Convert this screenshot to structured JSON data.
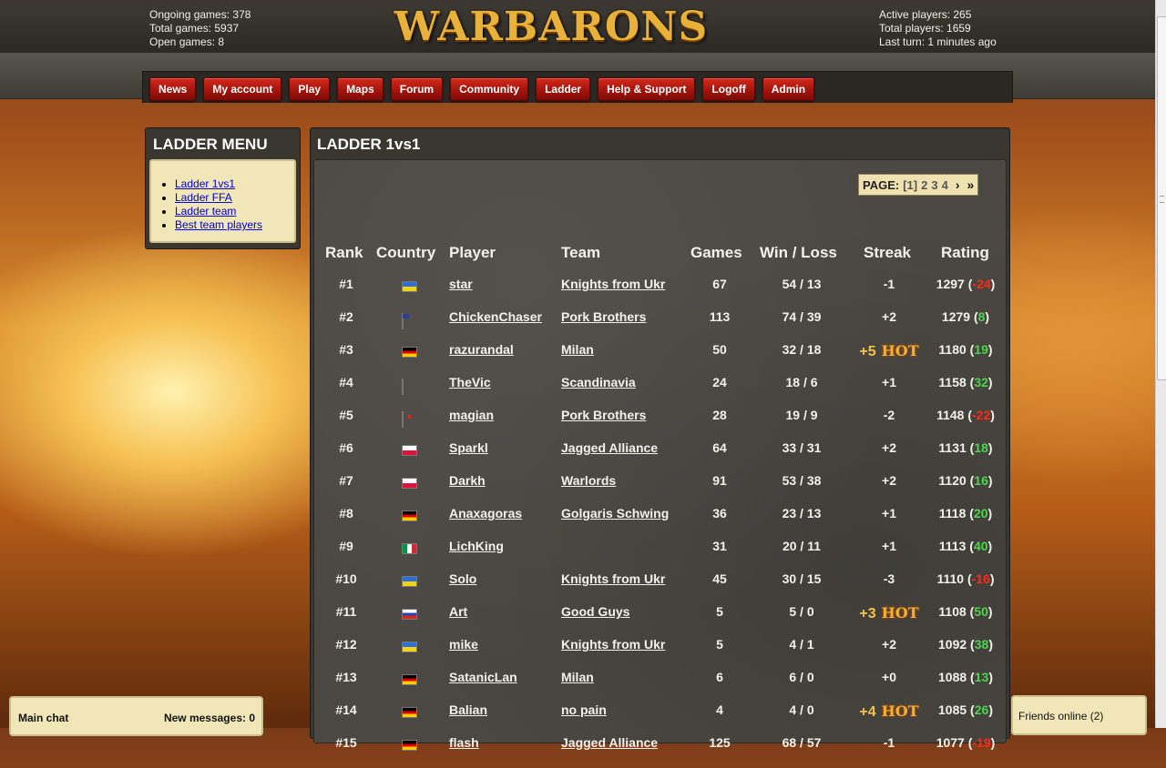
{
  "header": {
    "logo": "WARBARONS",
    "stats_left": [
      "Ongoing games: 378",
      "Total games: 5937",
      "Open games: 8"
    ],
    "stats_right": [
      "Active players: 265",
      "Total players: 1659",
      "Last turn: 1 minutes ago"
    ]
  },
  "nav": [
    "News",
    "My account",
    "Play",
    "Maps",
    "Forum",
    "Community",
    "Ladder",
    "Help & Support",
    "Logoff",
    "Admin"
  ],
  "ladder_menu": {
    "title": "LADDER MENU",
    "items": [
      "Ladder 1vs1",
      "Ladder FFA",
      "Ladder team",
      "Best team players"
    ]
  },
  "main": {
    "title": "LADDER 1vs1",
    "pager": {
      "label": "PAGE:",
      "current": "[1]",
      "pages": [
        "2",
        "3",
        "4"
      ],
      "next": "›",
      "last": "»"
    },
    "columns": [
      "Rank",
      "Country",
      "Player",
      "Team",
      "Games",
      "Win / Loss",
      "Streak",
      "Rating"
    ],
    "rows": [
      {
        "rank": "#1",
        "flag": "ua",
        "player": "star",
        "team": "Knights from Ukr",
        "games": "67",
        "wl": "54 / 13",
        "streak": "-1",
        "hot": false,
        "rating": "1297",
        "delta": "-24"
      },
      {
        "rank": "#2",
        "flag": "us",
        "player": "ChickenChaser",
        "team": "Pork Brothers",
        "games": "113",
        "wl": "74 / 39",
        "streak": "+2",
        "hot": false,
        "rating": "1279",
        "delta": "8"
      },
      {
        "rank": "#3",
        "flag": "de",
        "player": "razurandal",
        "team": "Milan",
        "games": "50",
        "wl": "32 / 18",
        "streak": "+5",
        "hot": true,
        "rating": "1180",
        "delta": "19"
      },
      {
        "rank": "#4",
        "flag": "se",
        "player": "TheVic",
        "team": "Scandinavia",
        "games": "24",
        "wl": "18 / 6",
        "streak": "+1",
        "hot": false,
        "rating": "1158",
        "delta": "32"
      },
      {
        "rank": "#5",
        "flag": "ca",
        "player": "magian",
        "team": "Pork Brothers",
        "games": "28",
        "wl": "19 / 9",
        "streak": "-2",
        "hot": false,
        "rating": "1148",
        "delta": "-22"
      },
      {
        "rank": "#6",
        "flag": "pl",
        "player": "Sparkl",
        "team": "Jagged Alliance",
        "games": "64",
        "wl": "33 / 31",
        "streak": "+2",
        "hot": false,
        "rating": "1131",
        "delta": "18"
      },
      {
        "rank": "#7",
        "flag": "pl",
        "player": "Darkh",
        "team": "Warlords",
        "games": "91",
        "wl": "53 / 38",
        "streak": "+2",
        "hot": false,
        "rating": "1120",
        "delta": "16"
      },
      {
        "rank": "#8",
        "flag": "de",
        "player": "Anaxagoras",
        "team": "Golgaris Schwing",
        "games": "36",
        "wl": "23 / 13",
        "streak": "+1",
        "hot": false,
        "rating": "1118",
        "delta": "20"
      },
      {
        "rank": "#9",
        "flag": "it",
        "player": "LichKing",
        "team": "",
        "games": "31",
        "wl": "20 / 11",
        "streak": "+1",
        "hot": false,
        "rating": "1113",
        "delta": "40"
      },
      {
        "rank": "#10",
        "flag": "ua",
        "player": "Solo",
        "team": "Knights from Ukr",
        "games": "45",
        "wl": "30 / 15",
        "streak": "-3",
        "hot": false,
        "rating": "1110",
        "delta": "-16"
      },
      {
        "rank": "#11",
        "flag": "ru",
        "player": "Art",
        "team": "Good Guys",
        "games": "5",
        "wl": "5 / 0",
        "streak": "+3",
        "hot": true,
        "rating": "1108",
        "delta": "50"
      },
      {
        "rank": "#12",
        "flag": "ua",
        "player": "mike",
        "team": "Knights from Ukr",
        "games": "5",
        "wl": "4 / 1",
        "streak": "+2",
        "hot": false,
        "rating": "1092",
        "delta": "38"
      },
      {
        "rank": "#13",
        "flag": "de",
        "player": "SatanicLan",
        "team": "Milan",
        "games": "6",
        "wl": "6 / 0",
        "streak": "+0",
        "hot": false,
        "rating": "1088",
        "delta": "13"
      },
      {
        "rank": "#14",
        "flag": "de",
        "player": "Balian",
        "team": "no pain",
        "games": "4",
        "wl": "4 / 0",
        "streak": "+4",
        "hot": true,
        "rating": "1085",
        "delta": "26"
      },
      {
        "rank": "#15",
        "flag": "de",
        "player": "flash",
        "team": "Jagged Alliance",
        "games": "125",
        "wl": "68 / 57",
        "streak": "-1",
        "hot": false,
        "rating": "1077",
        "delta": "-19"
      }
    ],
    "hot_label": "HOT"
  },
  "chat": {
    "title": "Main chat",
    "messages": "New messages: 0"
  },
  "friends": {
    "label": "Friends online (2)"
  },
  "colors": {
    "positive": "#4cd44c",
    "negative": "#ff2a18",
    "button": "#b5180e",
    "panel": "#f1e6b8"
  }
}
